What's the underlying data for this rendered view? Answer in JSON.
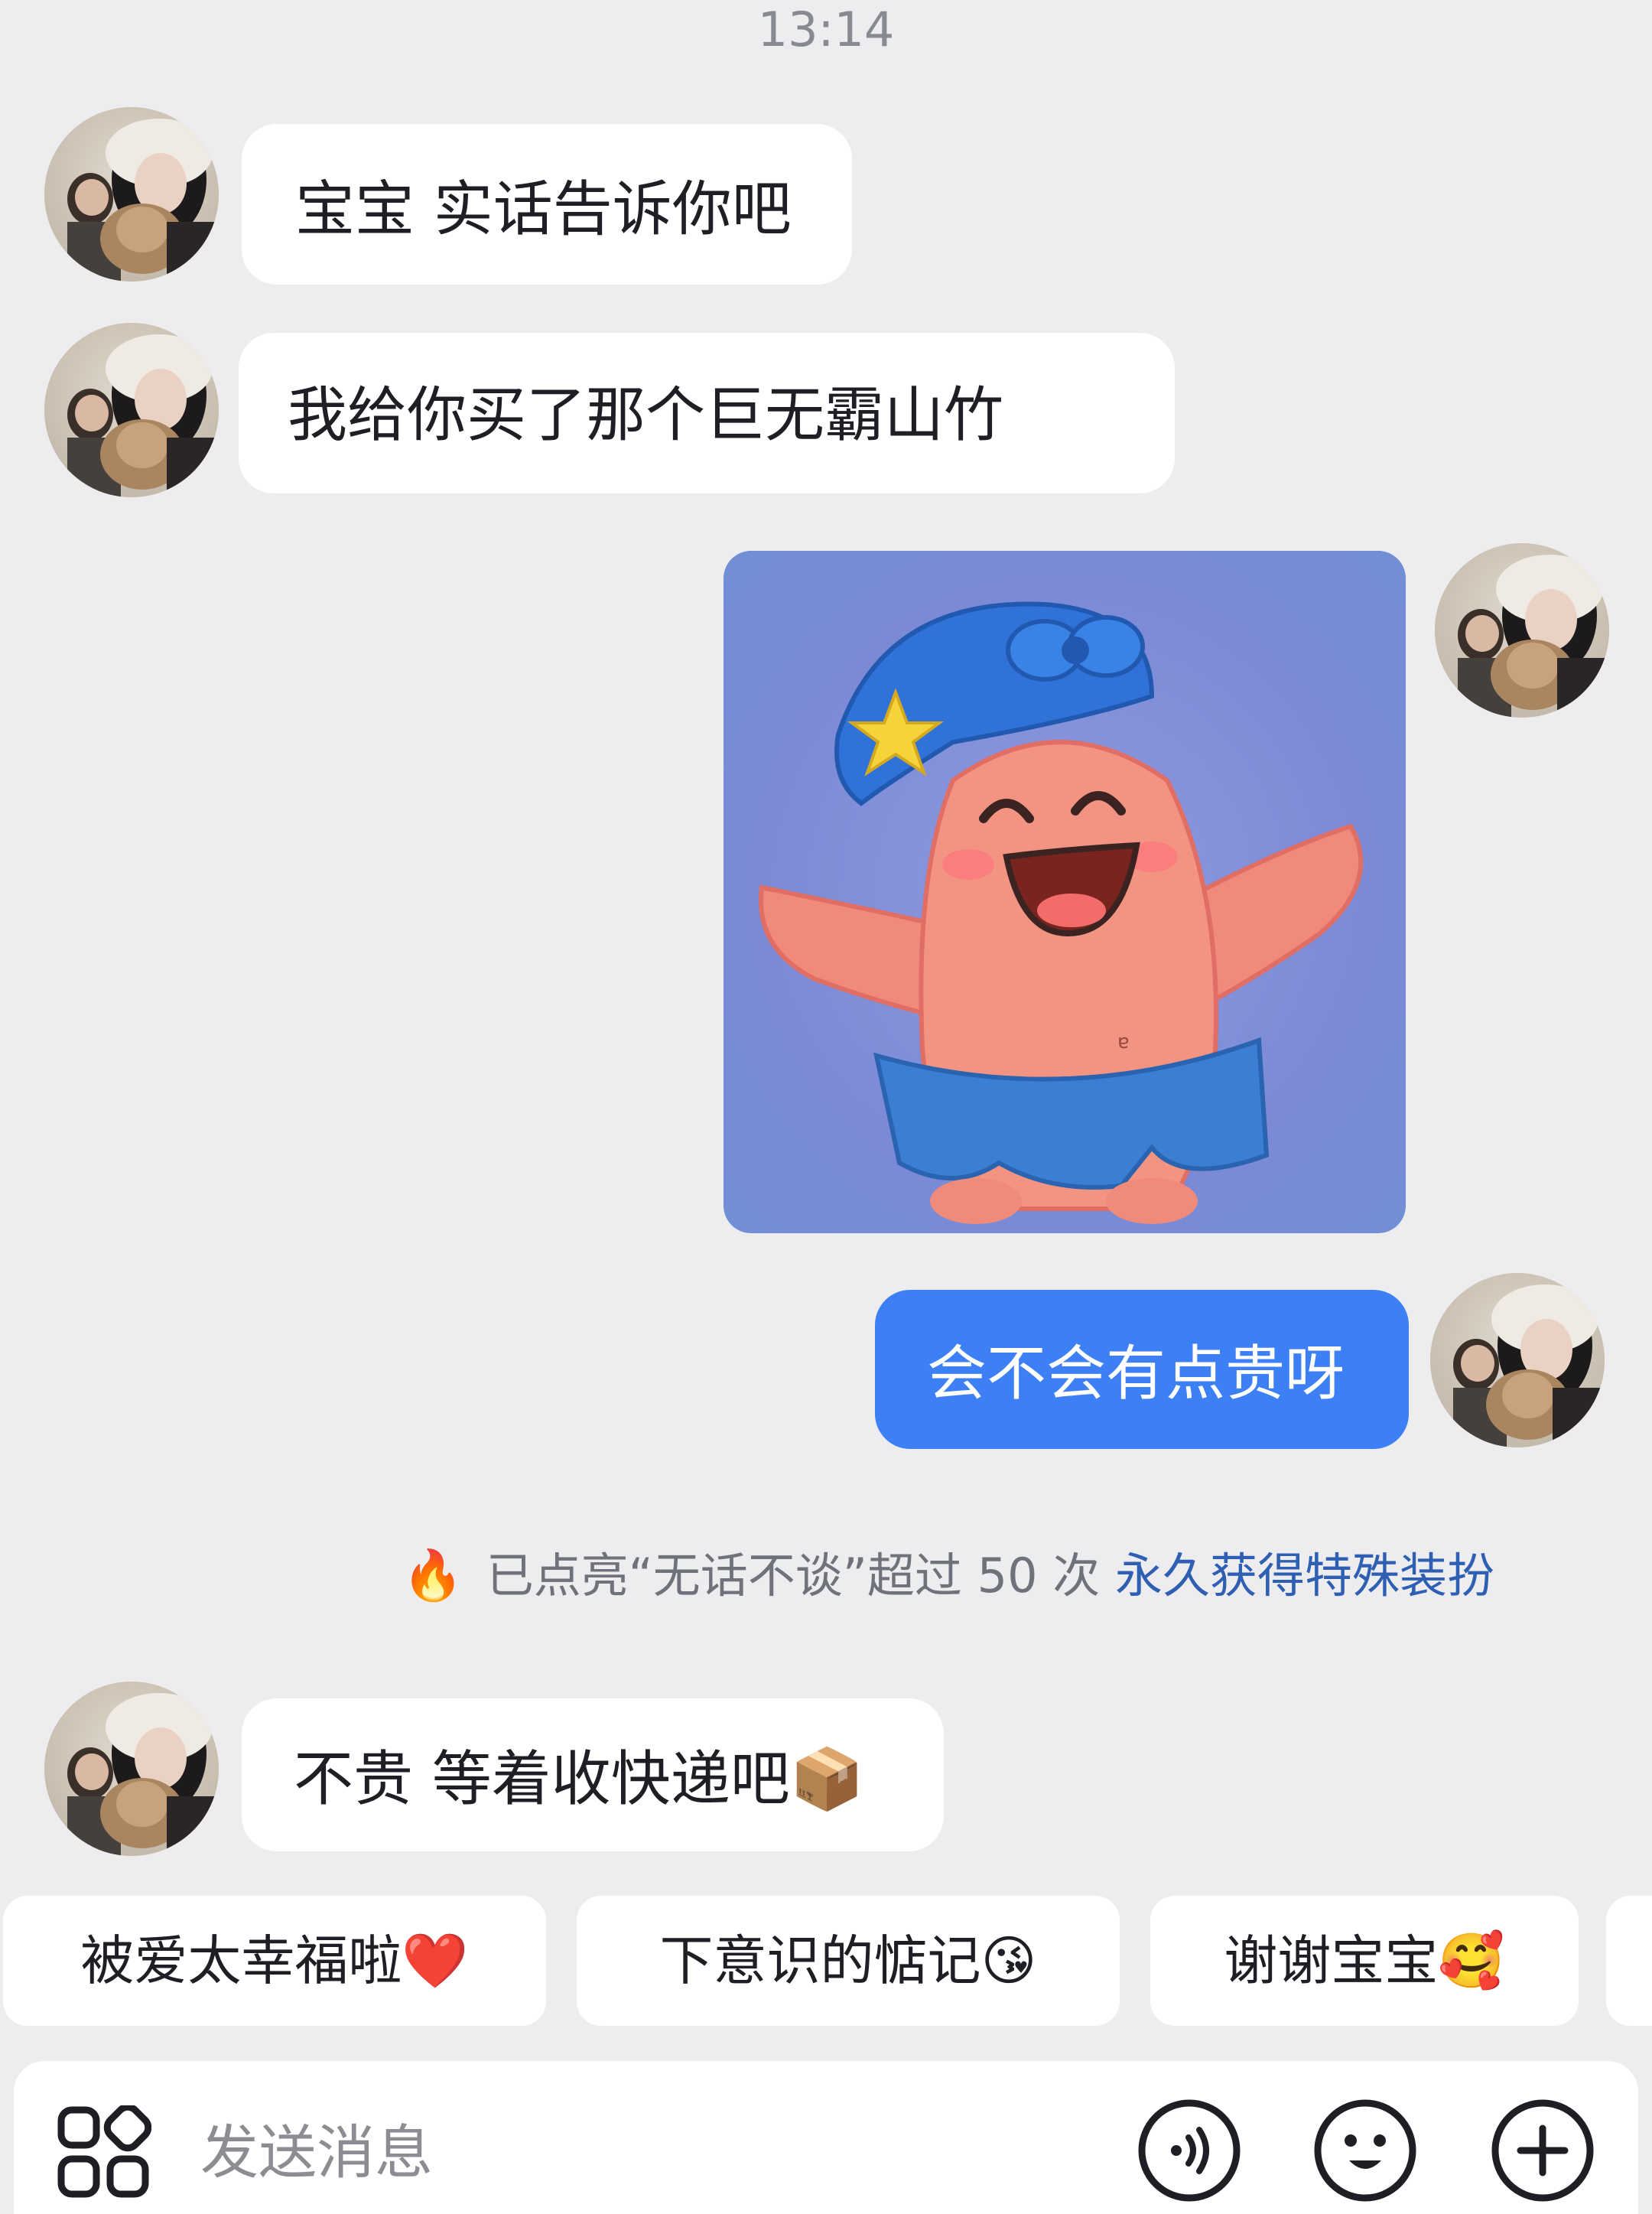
{
  "status": {
    "time": "13:14"
  },
  "messages": [
    {
      "side": "them",
      "text": "宝宝 实话告诉你吧"
    },
    {
      "side": "them",
      "text": "我给你买了那个巨无霸山竹"
    },
    {
      "side": "me",
      "type": "sticker",
      "sticker_name": "happy-patrick-star-sticker"
    },
    {
      "side": "me",
      "text": "会不会有点贵呀"
    },
    {
      "side": "them",
      "text": "不贵 等着收快递吧📦"
    }
  ],
  "system_notice": {
    "icon": "🔥",
    "text": "已点亮“无话不谈”超过 50 次",
    "link": "永久获得特殊装扮"
  },
  "quick_replies": [
    "被爱太幸福啦❤️",
    "下意识的惦记😘",
    "谢谢宝宝🥰"
  ],
  "composer": {
    "placeholder": "发送消息",
    "icons": [
      "apps-grid-icon",
      "voice-icon",
      "emoji-icon",
      "plus-icon"
    ]
  },
  "colors": {
    "background": "#ededef",
    "my_bubble": "#3d7ff5",
    "their_bubble": "#ffffff",
    "notice_link": "#2e5fb3"
  }
}
